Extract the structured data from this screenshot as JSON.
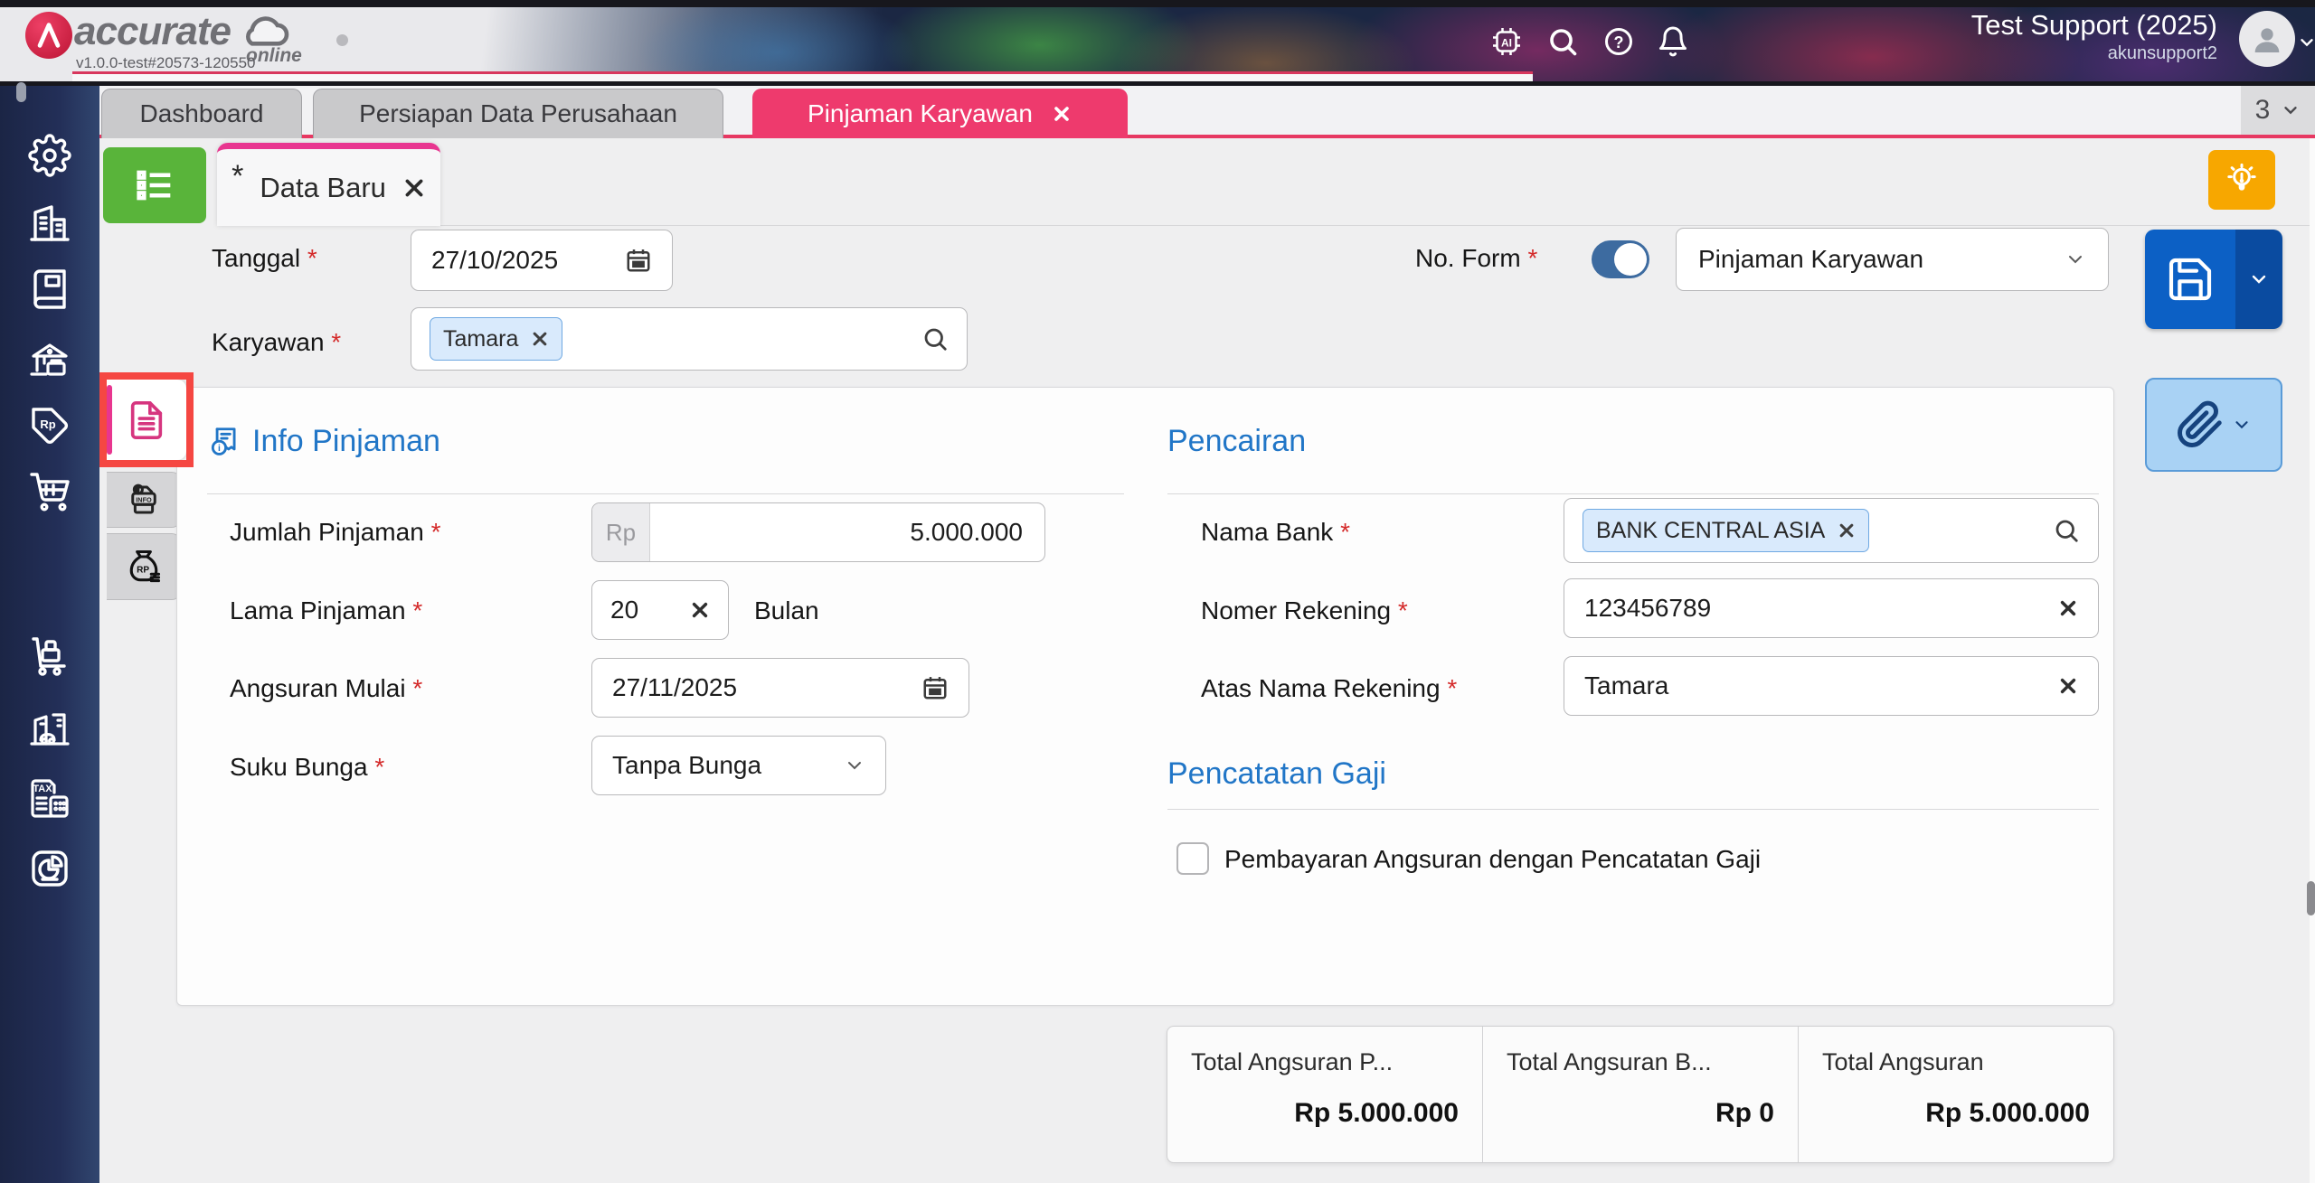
{
  "ui": {
    "required_marker": "*"
  },
  "topbar": {
    "logo_text": "accurate",
    "logo_online": "online",
    "version": "v1.0.0-test#20573-120550",
    "user_name": "Test Support (2025)",
    "user_account": "akunsupport2"
  },
  "page_tabs": {
    "tabs": [
      {
        "label": "Dashboard"
      },
      {
        "label": "Persiapan Data Perusahaan"
      },
      {
        "label": "Pinjaman Karyawan"
      }
    ],
    "counter": "3"
  },
  "document_tab": {
    "dirty_marker": "*",
    "label": "Data Baru"
  },
  "form_header": {
    "tanggal_label": "Tanggal",
    "tanggal_value": "27/10/2025",
    "karyawan_label": "Karyawan",
    "karyawan_chip": "Tamara",
    "no_form_label": "No. Form",
    "form_type_value": "Pinjaman Karyawan"
  },
  "info_pinjaman": {
    "title": "Info Pinjaman",
    "jumlah_label": "Jumlah Pinjaman",
    "currency_prefix": "Rp",
    "jumlah_value": "5.000.000",
    "lama_label": "Lama Pinjaman",
    "lama_value": "20",
    "lama_unit": "Bulan",
    "angsuran_label": "Angsuran Mulai",
    "angsuran_value": "27/11/2025",
    "suku_label": "Suku Bunga",
    "suku_value": "Tanpa Bunga"
  },
  "pencairan": {
    "title": "Pencairan",
    "nama_bank_label": "Nama Bank",
    "nama_bank_chip": "BANK CENTRAL ASIA",
    "nomer_rekening_label": "Nomer Rekening",
    "nomer_rekening_value": "123456789",
    "atas_nama_label": "Atas Nama Rekening",
    "atas_nama_value": "Tamara"
  },
  "pencatatan_gaji": {
    "title": "Pencatatan Gaji",
    "checkbox_label": "Pembayaran Angsuran dengan Pencatatan Gaji"
  },
  "totals": {
    "columns": [
      {
        "label": "Total Angsuran P...",
        "value": "Rp 5.000.000"
      },
      {
        "label": "Total Angsuran B...",
        "value": "Rp 0"
      },
      {
        "label": "Total Angsuran",
        "value": "Rp 5.000.000"
      }
    ]
  },
  "colors": {
    "accent_pink": "#ee3a6d",
    "accent_magenta": "#e8358f",
    "primary_blue": "#0c60c5",
    "heading_blue": "#2176c7",
    "green_button": "#59b43a",
    "hint_orange": "#f7a700",
    "highlight_red": "#f54742"
  }
}
